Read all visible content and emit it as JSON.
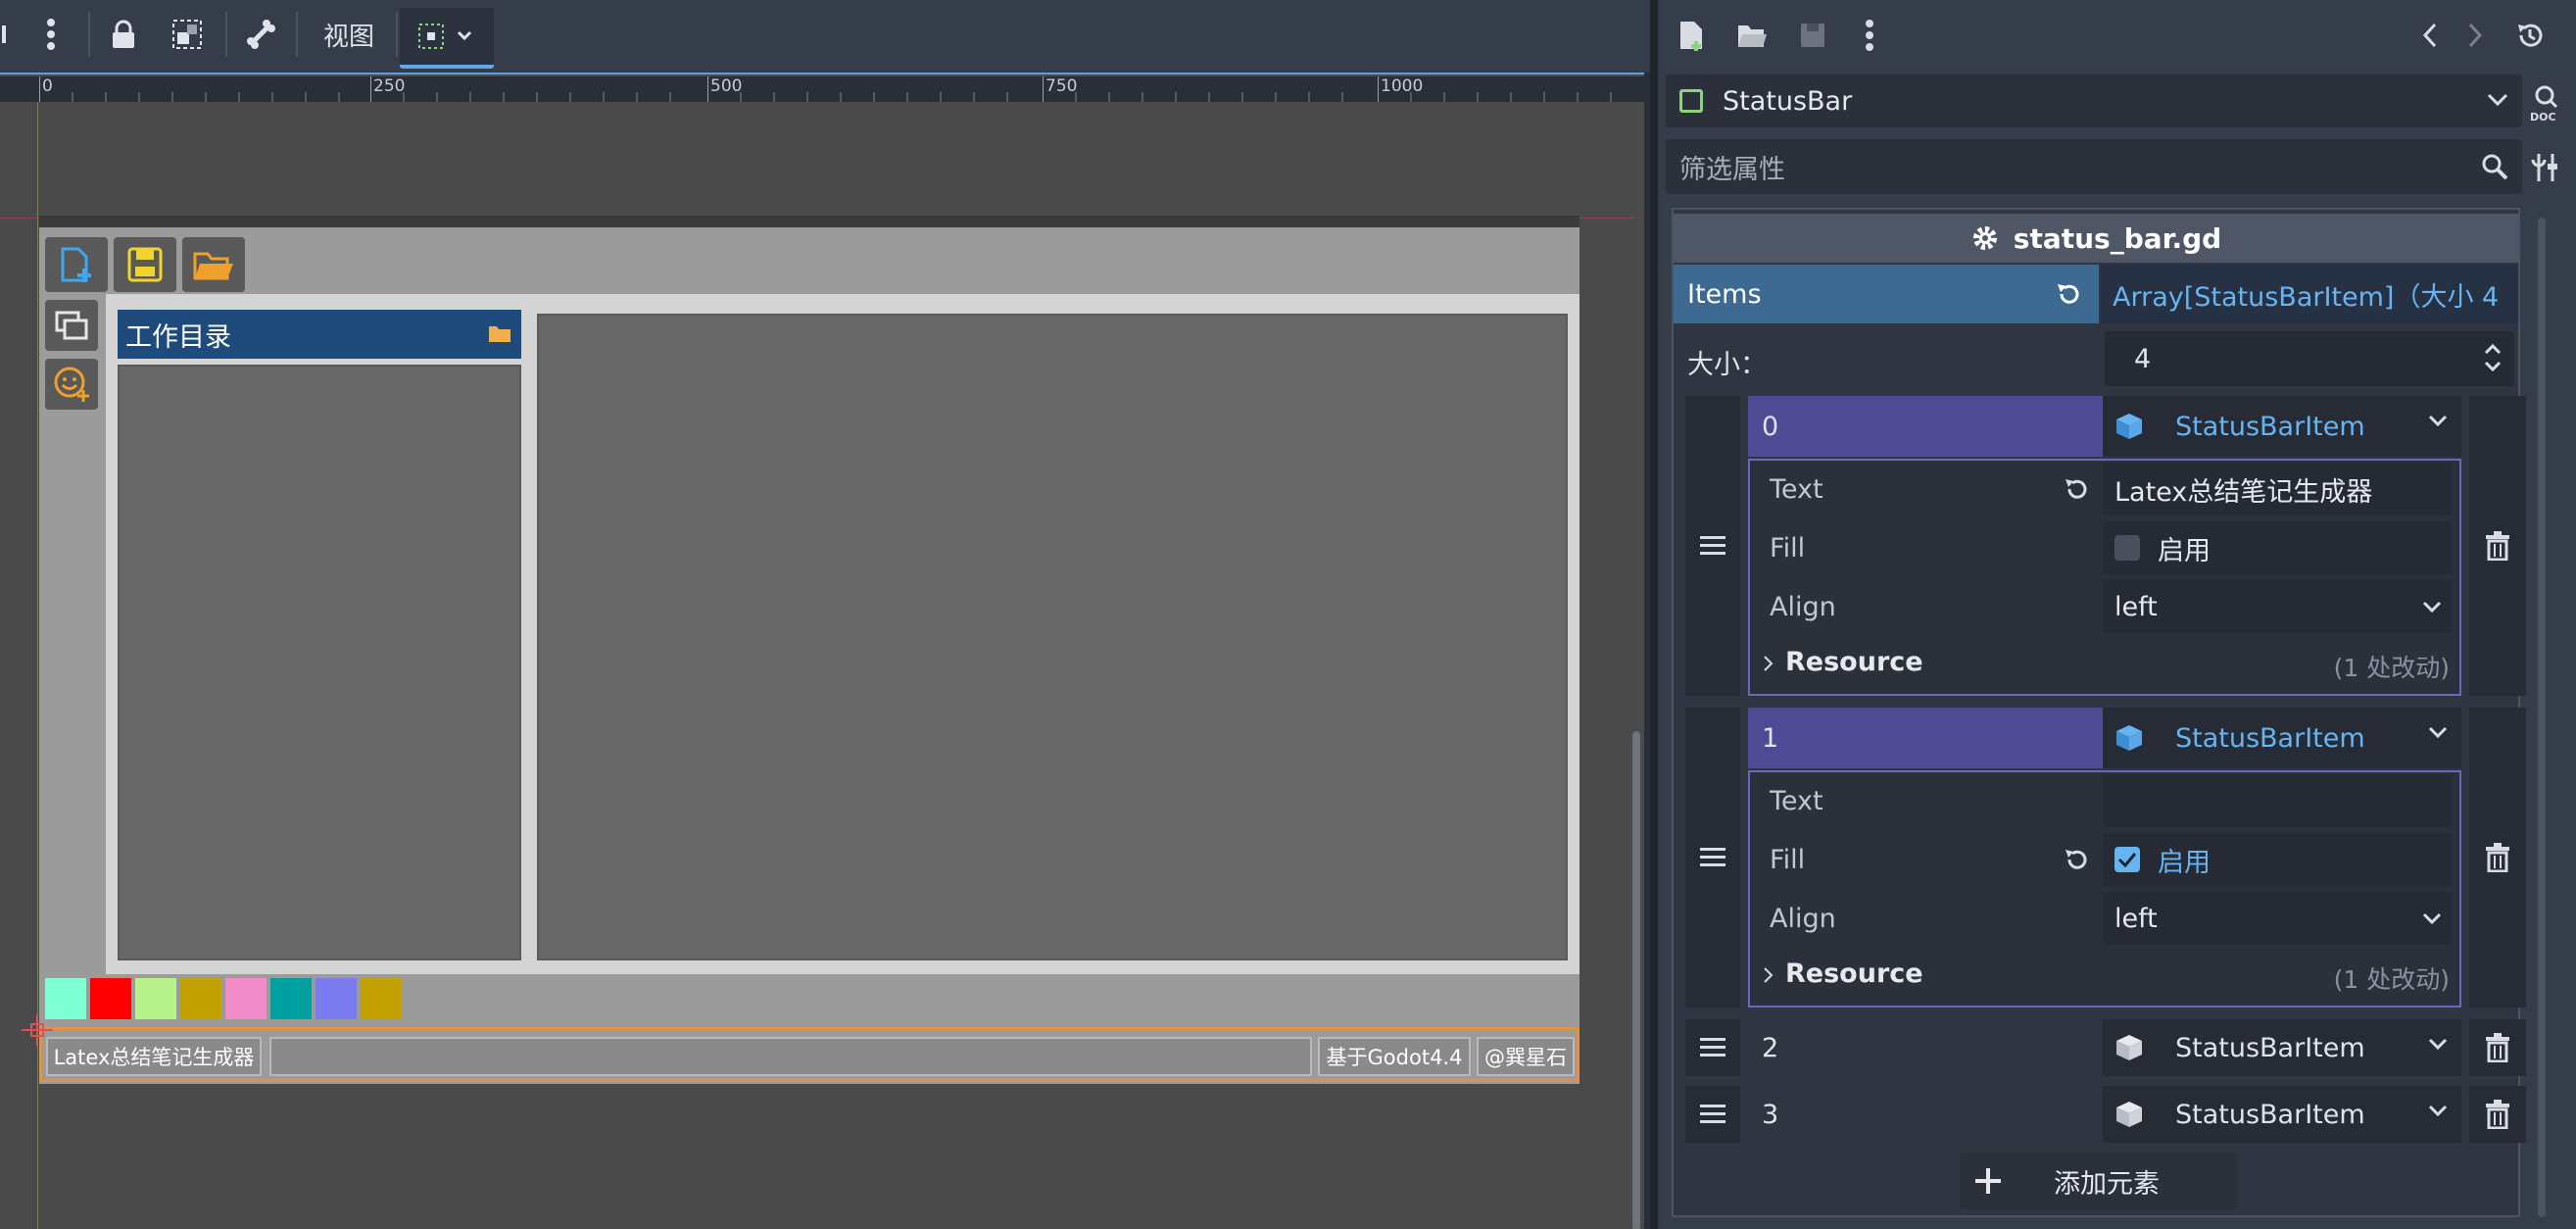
{
  "toolbar": {
    "view_label": "视图"
  },
  "ruler": {
    "marks": [
      "0",
      "250",
      "500",
      "750",
      "1000"
    ]
  },
  "app": {
    "dir_title": "工作目录",
    "swatch_colors": [
      "#7fffd4",
      "#ff0000",
      "#b8f28c",
      "#c2a100",
      "#f28cc8",
      "#00a0a0",
      "#7b7bf0",
      "#c2a100"
    ],
    "status_items": [
      "Latex总结笔记生成器",
      "",
      "基于Godot4.4",
      "@巽星石"
    ]
  },
  "inspector": {
    "node_name": "StatusBar",
    "filter_placeholder": "筛选属性",
    "script_name": "status_bar.gd",
    "items_label": "Items",
    "items_value": "Array[StatusBarItem]（大小 4",
    "size_label": "大小：",
    "size_value": "4",
    "elements": [
      {
        "index": "0",
        "type": "StatusBarItem",
        "text_label": "Text",
        "text_value": "Latex总结笔记生成器",
        "fill_label": "Fill",
        "fill_value": "启用",
        "fill_checked": false,
        "align_label": "Align",
        "align_value": "left",
        "resource_label": "Resource",
        "resource_note": "(1 处改动)"
      },
      {
        "index": "1",
        "type": "StatusBarItem",
        "text_label": "Text",
        "text_value": "",
        "fill_label": "Fill",
        "fill_value": "启用",
        "fill_checked": true,
        "align_label": "Align",
        "align_value": "left",
        "resource_label": "Resource",
        "resource_note": "(1 处改动)"
      },
      {
        "index": "2",
        "type": "StatusBarItem"
      },
      {
        "index": "3",
        "type": "StatusBarItem"
      }
    ],
    "add_element_label": "添加元素"
  },
  "colors": {
    "accent": "#5fa7e8",
    "selection_orange": "#e39245",
    "element_header": "#4e4b94",
    "items_header": "#3d6a93",
    "dir_header": "#1e4b7c"
  }
}
